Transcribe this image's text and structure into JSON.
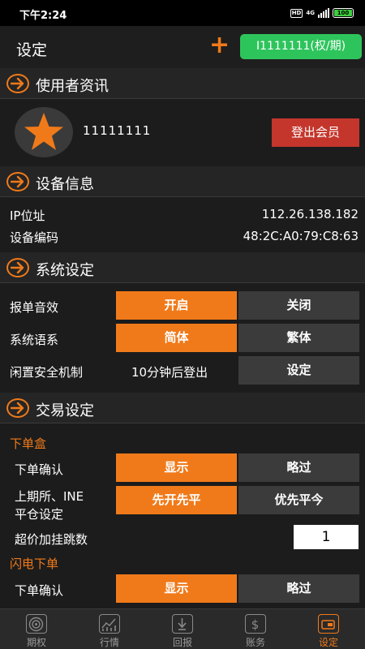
{
  "status_bar": {
    "time": "下午2:24",
    "hd": "HD",
    "network": "4G",
    "battery": "100"
  },
  "header": {
    "title": "设定",
    "add_icon": "+",
    "account": "I1111111(权/期)"
  },
  "sections": {
    "user": "使用者资讯",
    "device": "设备信息",
    "system": "系统设定",
    "trade": "交易设定"
  },
  "user": {
    "id": "11111111",
    "logout": "登出会员"
  },
  "device": {
    "ip_label": "IP位址",
    "ip_value": "112.26.138.182",
    "code_label": "设备编码",
    "code_value": "48:2C:A0:79:C8:63"
  },
  "system": {
    "sound_label": "报单音效",
    "sound_on": "开启",
    "sound_off": "关闭",
    "sound_selected": "开启",
    "lang_label": "系统语系",
    "lang_simplified": "简体",
    "lang_traditional": "繁体",
    "lang_selected": "简体",
    "idle_label": "闲置安全机制",
    "idle_value": "10分钟后登出",
    "idle_button": "设定"
  },
  "trade": {
    "order_box_title": "下单盒",
    "confirm_label": "下单确认",
    "confirm_show": "显示",
    "confirm_skip": "略过",
    "confirm_selected": "显示",
    "close_label_line1": "上期所、INE",
    "close_label_line2": "平仓设定",
    "close_open_first": "先开先平",
    "close_today_first": "优先平今",
    "close_selected": "先开先平",
    "tick_label": "超价加挂跳数",
    "tick_value": "1",
    "flash_title": "闪电下单",
    "flash_confirm_label": "下单确认",
    "flash_confirm_show": "显示",
    "flash_confirm_skip": "略过",
    "flash_selected": "显示"
  },
  "tabs": [
    {
      "label": "期权",
      "icon": "target-icon"
    },
    {
      "label": "行情",
      "icon": "chart-icon"
    },
    {
      "label": "回报",
      "icon": "report-icon"
    },
    {
      "label": "账务",
      "icon": "dollar-icon"
    },
    {
      "label": "设定",
      "icon": "settings-icon",
      "active": true
    }
  ],
  "colors": {
    "accent": "#f07a1a",
    "account_bg": "#2ec45c",
    "logout_bg": "#c4362c",
    "background": "#1c1c1c"
  }
}
